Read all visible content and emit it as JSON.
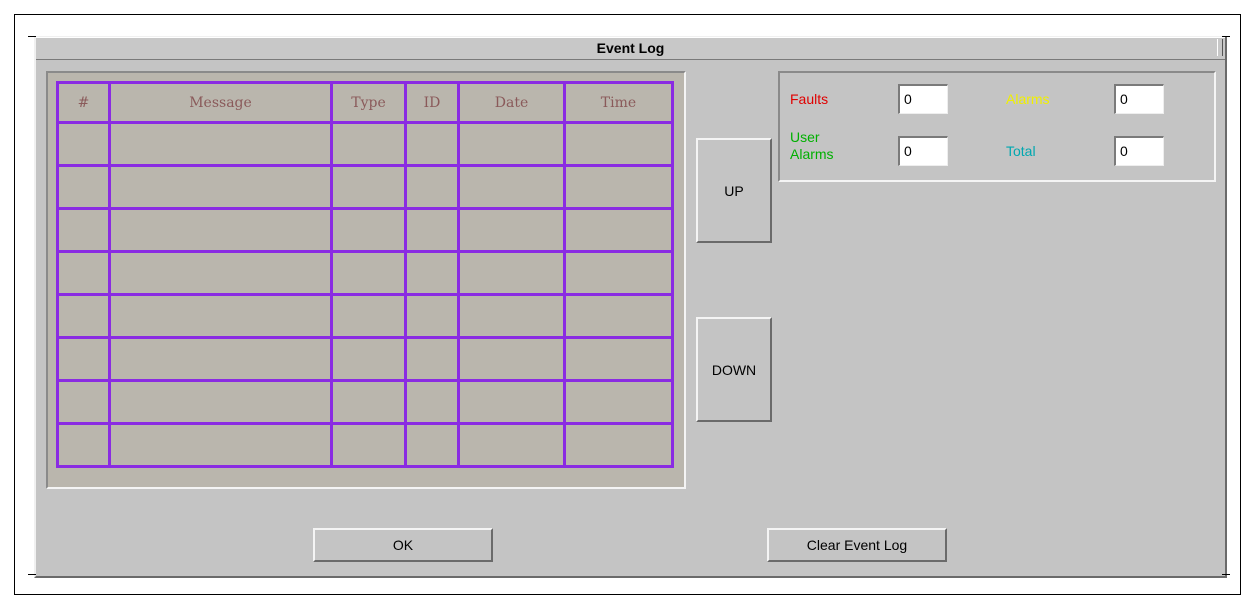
{
  "window": {
    "title": "Event Log"
  },
  "table": {
    "columns": [
      "#",
      "Message",
      "Type",
      "ID",
      "Date",
      "Time"
    ],
    "rows": [
      [
        "",
        "",
        "",
        "",
        "",
        ""
      ],
      [
        "",
        "",
        "",
        "",
        "",
        ""
      ],
      [
        "",
        "",
        "",
        "",
        "",
        ""
      ],
      [
        "",
        "",
        "",
        "",
        "",
        ""
      ],
      [
        "",
        "",
        "",
        "",
        "",
        ""
      ],
      [
        "",
        "",
        "",
        "",
        "",
        ""
      ],
      [
        "",
        "",
        "",
        "",
        "",
        ""
      ],
      [
        "",
        "",
        "",
        "",
        "",
        ""
      ]
    ]
  },
  "nav": {
    "up_label": "UP",
    "down_label": "DOWN"
  },
  "counts": {
    "faults": {
      "label": "Faults",
      "value": "0",
      "color": "#e00000"
    },
    "alarms": {
      "label": "Alarms",
      "value": "0",
      "color": "#f0f000"
    },
    "user_alarms": {
      "label_line1": "User",
      "label_line2": "Alarms",
      "value": "0",
      "color": "#00b000"
    },
    "total": {
      "label": "Total",
      "value": "0",
      "color": "#00a8b0"
    }
  },
  "footer": {
    "ok_label": "OK",
    "clear_label": "Clear Event Log"
  }
}
